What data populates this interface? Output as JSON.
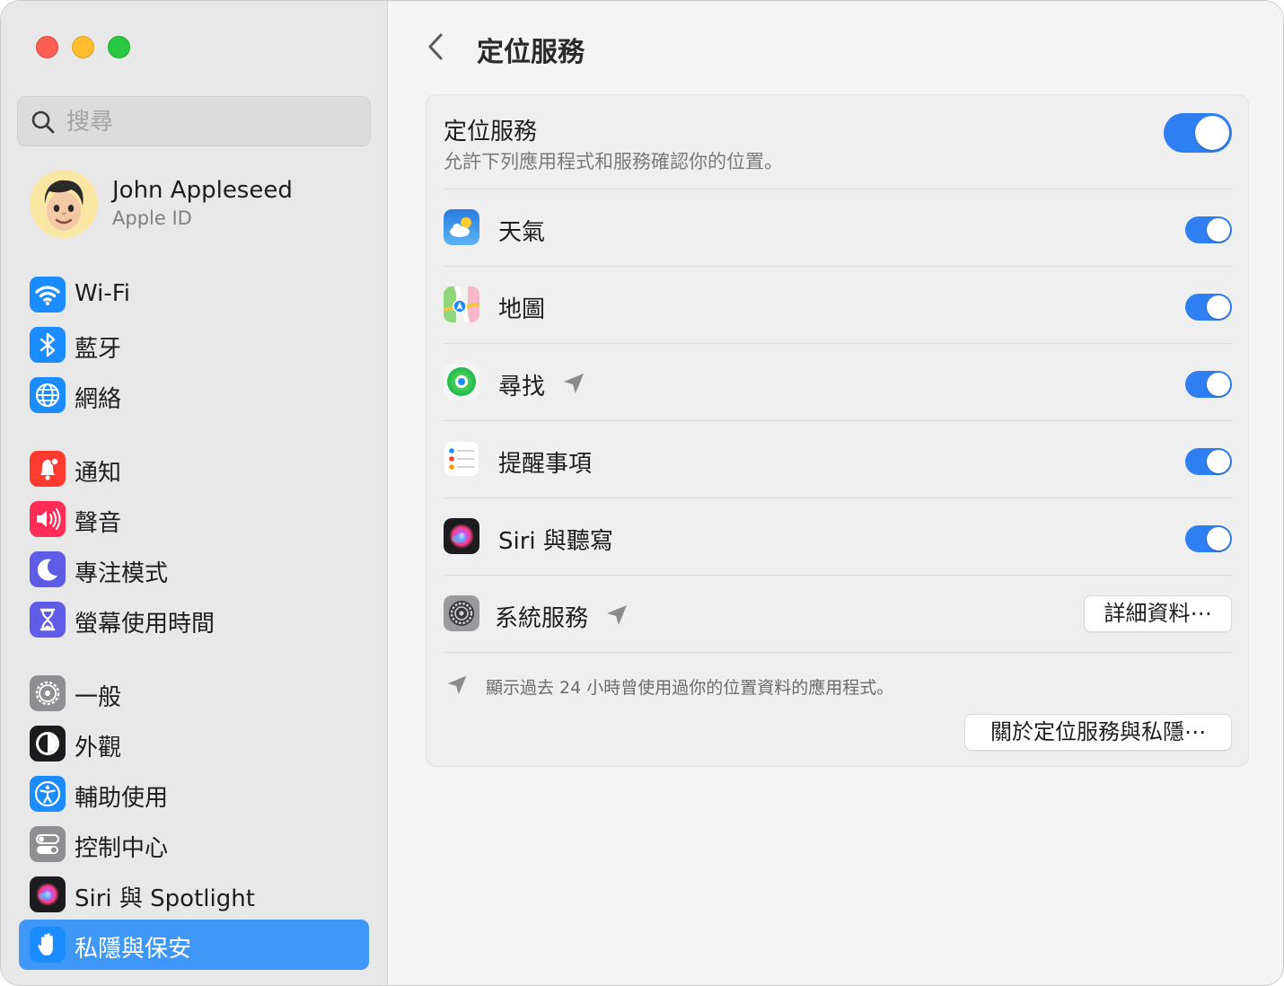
{
  "sidebar": {
    "search": {
      "placeholder": "搜尋",
      "value": ""
    },
    "profile": {
      "name": "John Appleseed",
      "subtitle": "Apple ID"
    },
    "items": [
      {
        "label": "Wi-Fi",
        "icon": "wifi-icon",
        "color": "#1a8cff"
      },
      {
        "label": "藍牙",
        "icon": "bluetooth-icon",
        "color": "#1a8cff"
      },
      {
        "label": "網絡",
        "icon": "globe-icon",
        "color": "#1a8cff"
      },
      {
        "label": "通知",
        "icon": "bell-icon",
        "color": "#ff3b30"
      },
      {
        "label": "聲音",
        "icon": "speaker-icon",
        "color": "#ff2d55"
      },
      {
        "label": "專注模式",
        "icon": "moon-icon",
        "color": "#5e5ce6"
      },
      {
        "label": "螢幕使用時間",
        "icon": "hourglass-icon",
        "color": "#5e5ce6"
      },
      {
        "label": "一般",
        "icon": "gear-icon",
        "color": "#8e8e93"
      },
      {
        "label": "外觀",
        "icon": "appearance-icon",
        "color": "#1c1c1e"
      },
      {
        "label": "輔助使用",
        "icon": "accessibility-icon",
        "color": "#1a8cff"
      },
      {
        "label": "控制中心",
        "icon": "control-center-icon",
        "color": "#8e8e93"
      },
      {
        "label": "Siri 與 Spotlight",
        "icon": "siri-icon",
        "color": "#1c1c1e"
      },
      {
        "label": "私隱與保安",
        "icon": "hand-icon",
        "color": "#1a8cff",
        "selected": true
      }
    ]
  },
  "header": {
    "title": "定位服務"
  },
  "location": {
    "title": "定位服務",
    "description": "允許下列應用程式和服務確認你的位置。",
    "enabled": true
  },
  "apps": [
    {
      "name": "天氣",
      "icon": "weather-icon",
      "enabled": true,
      "recent": false
    },
    {
      "name": "地圖",
      "icon": "maps-icon",
      "enabled": true,
      "recent": false
    },
    {
      "name": "尋找",
      "icon": "find-my-icon",
      "enabled": true,
      "recent": true
    },
    {
      "name": "提醒事項",
      "icon": "reminders-icon",
      "enabled": true,
      "recent": false
    },
    {
      "name": "Siri 與聽寫",
      "icon": "siri-icon",
      "enabled": true,
      "recent": false
    }
  ],
  "system_services": {
    "name": "系統服務",
    "icon": "system-settings-icon",
    "recent": true,
    "details_label": "詳細資料⋯"
  },
  "footer": {
    "note": "顯示過去 24 小時曾使用過你的位置資料的應用程式。",
    "about_label": "關於定位服務與私隱⋯"
  },
  "colors": {
    "accent": "#2f7ff2",
    "selection": "#3f97f7"
  }
}
